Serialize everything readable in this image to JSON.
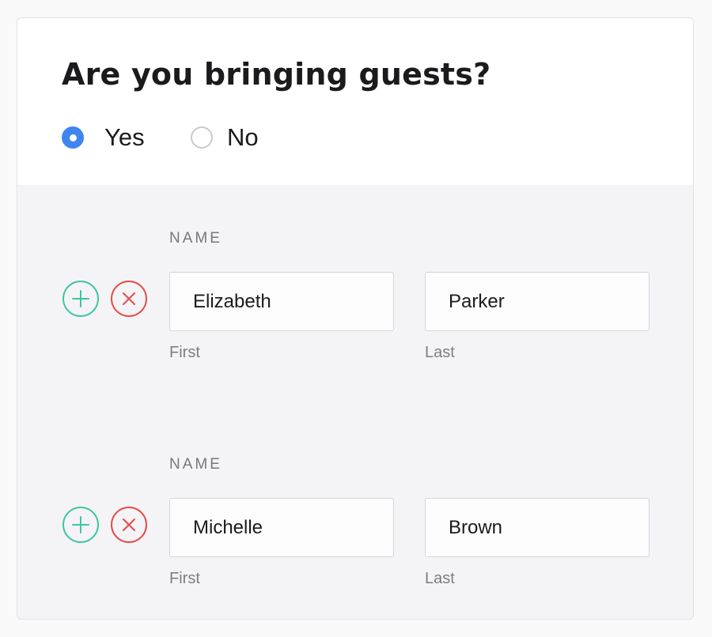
{
  "question": {
    "title": "Are you bringing guests?",
    "options": [
      {
        "label": "Yes",
        "selected": true
      },
      {
        "label": "No",
        "selected": false
      }
    ]
  },
  "guests": [
    {
      "heading": "NAME",
      "first_value": "Elizabeth",
      "last_value": "Parker",
      "first_caption": "First",
      "last_caption": "Last"
    },
    {
      "heading": "NAME",
      "first_value": "Michelle",
      "last_value": "Brown",
      "first_caption": "First",
      "last_caption": "Last"
    }
  ],
  "colors": {
    "accent_blue": "#3e85f0",
    "add_green": "#3ec6a0",
    "remove_red": "#e84a4a",
    "section_bg": "#f4f4f6",
    "card_bg": "#ffffff"
  },
  "icons": {
    "add": "plus-circle-icon",
    "remove": "x-circle-icon"
  }
}
